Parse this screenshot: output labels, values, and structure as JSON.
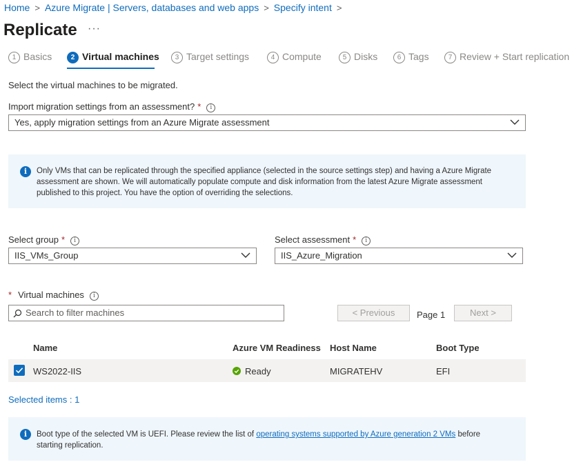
{
  "breadcrumb": {
    "items": [
      "Home",
      "Azure Migrate | Servers, databases and web apps",
      "Specify intent"
    ]
  },
  "page": {
    "title": "Replicate",
    "more_label": "···"
  },
  "steps": [
    {
      "num": "1",
      "label": "Basics",
      "active": false
    },
    {
      "num": "2",
      "label": "Virtual machines",
      "active": true
    },
    {
      "num": "3",
      "label": "Target settings",
      "active": false
    },
    {
      "num": "4",
      "label": "Compute",
      "active": false
    },
    {
      "num": "5",
      "label": "Disks",
      "active": false
    },
    {
      "num": "6",
      "label": "Tags",
      "active": false
    },
    {
      "num": "7",
      "label": "Review + Start replication",
      "active": false
    }
  ],
  "intro": "Select the virtual machines to be migrated.",
  "import": {
    "label": "Import migration settings from an assessment?",
    "required": "*",
    "value": "Yes, apply migration settings from an Azure Migrate assessment"
  },
  "info1": {
    "line1": "Only VMs that can be replicated through the specified appliance (selected  in the source settings step) and having a Azure Migrate",
    "line2": "assessment are shown. We will automatically populate compute and disk information from the latest Azure Migrate assessment",
    "line3": "published to this project. You have the option of overriding the selections."
  },
  "group": {
    "label": "Select group",
    "required": "*",
    "value": "IIS_VMs_Group"
  },
  "assessment": {
    "label": "Select assessment",
    "required": "*",
    "value": "IIS_Azure_Migration"
  },
  "vms": {
    "label": "Virtual machines",
    "required": "*",
    "search_placeholder": "Search to filter machines",
    "prev_label": "< Previous",
    "page_label": "Page 1",
    "next_label": "Next >"
  },
  "table": {
    "headers": [
      "Name",
      "Azure VM Readiness",
      "Host Name",
      "Boot Type"
    ],
    "rows": [
      {
        "name": "WS2022-IIS",
        "readiness": "Ready",
        "host": "MIGRATEHV",
        "boot": "EFI",
        "checked": true
      }
    ]
  },
  "selected_items": "Selected items : 1",
  "info2": {
    "before_link": "Boot type of the selected VM is UEFI. Please review the list of ",
    "link": "operating systems supported by Azure generation 2 VMs",
    "after_link": " before",
    "line2": "starting replication."
  },
  "colors": {
    "accent": "#0f6cbd",
    "ready": "#57a300",
    "info_bg": "#eff6fc"
  }
}
